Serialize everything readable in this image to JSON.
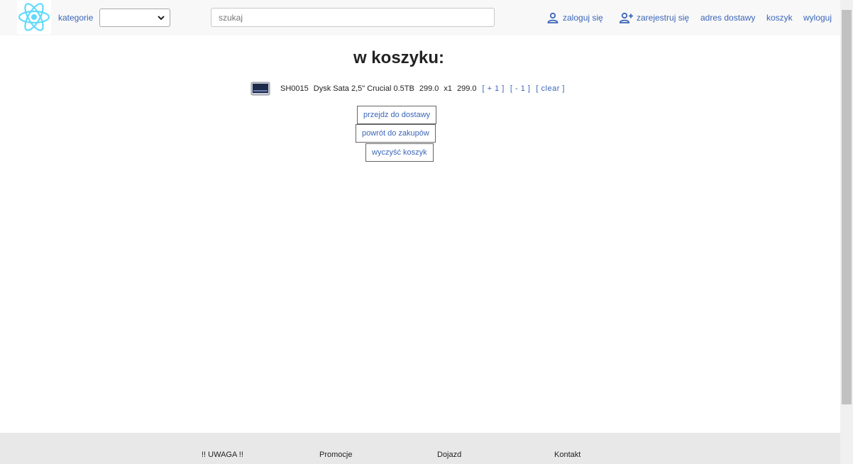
{
  "nav": {
    "categories_label": "kategorie",
    "categories_selected": "",
    "search_placeholder": "szukaj",
    "login": "zaloguj się",
    "register": "zarejestruj się",
    "address": "adres dostawy",
    "cart": "koszyk",
    "logout": "wyloguj"
  },
  "main": {
    "title": "w koszyku:",
    "items": [
      {
        "code": "SH0015",
        "name": "Dysk Sata 2,5\" Crucial 0.5TB",
        "price": "299.0",
        "qty": "x1",
        "total": "299.0",
        "plus": "[ + 1 ]",
        "minus": "[ - 1 ]",
        "clear": "[ clear ]"
      }
    ],
    "buttons": {
      "delivery": "przejdz do dostawy",
      "back": "powrót do zakupów",
      "clear_cart": "wyczyść koszyk"
    }
  },
  "footer": {
    "links": [
      "!! UWAGA !!",
      "Promocje",
      "Dojazd",
      "Kontakt"
    ]
  },
  "colors": {
    "link": "#3a66b8",
    "navbar_bg": "#f8f8f8",
    "footer_bg": "#e8e8e8",
    "logo": "#61dafb"
  },
  "icons": [
    "react-logo-icon",
    "chevron-down-icon",
    "user-icon",
    "user-plus-icon",
    "ssd-drive-icon"
  ]
}
